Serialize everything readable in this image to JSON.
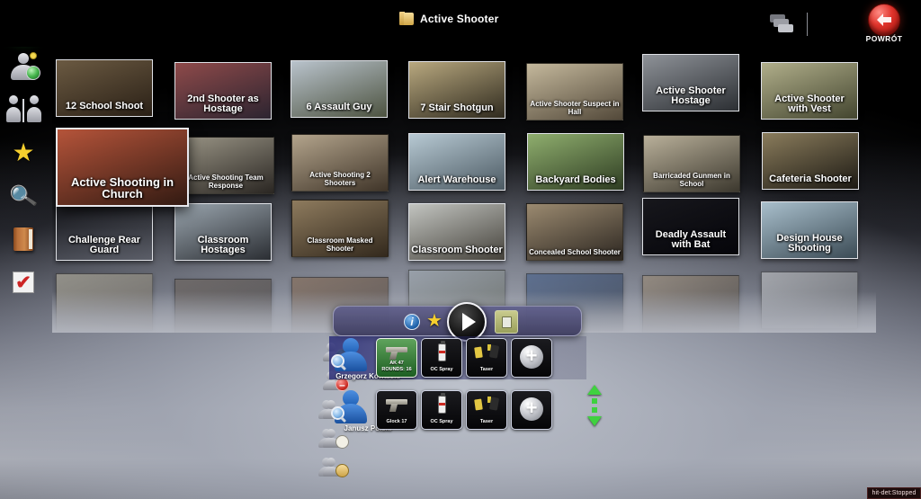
{
  "header": {
    "title": "Active Shooter",
    "folder_icon": "folder-icon",
    "cascade_view_icon": "cascade-view-icon",
    "grid_view_icon": "grid-view-icon",
    "back_button_label": "POWRÓT",
    "back_button_icon": "back-arrow-icon"
  },
  "sidebar": {
    "items": [
      {
        "name": "logo",
        "icon": "film-reel-logo-icon"
      },
      {
        "name": "record-participant",
        "icon": "person-record-icon"
      },
      {
        "name": "compare-participants",
        "icon": "two-persons-split-icon"
      },
      {
        "name": "favorites",
        "icon": "star-icon"
      },
      {
        "name": "search",
        "icon": "magnifier-icon"
      },
      {
        "name": "library",
        "icon": "book-icon"
      },
      {
        "name": "results",
        "icon": "red-check-icon"
      }
    ]
  },
  "grid": {
    "rows": [
      {
        "items": [
          {
            "label": "12 School Shoot",
            "style": "med"
          },
          {
            "label": "2nd Shooter as Hostage",
            "style": "med"
          },
          {
            "label": "6 Assault Guy",
            "style": "med"
          },
          {
            "label": "7 Stair Shotgun",
            "style": "med"
          },
          {
            "label": "Active Shooter Suspect in Hall",
            "style": "small"
          },
          {
            "label": "Active Shooter Hostage",
            "style": "med"
          },
          {
            "label": "Active Shooter with Vest",
            "style": "med"
          }
        ]
      },
      {
        "items": [
          {
            "label": "Active Shooting in Church",
            "style": "big"
          },
          {
            "label": "Active Shooting Team Response",
            "style": "small"
          },
          {
            "label": "Active Shooting 2 Shooters",
            "style": "small"
          },
          {
            "label": "Alert Warehouse",
            "style": "med"
          },
          {
            "label": "Backyard Bodies",
            "style": "med"
          },
          {
            "label": "Barricaded Gunmen in School",
            "style": "small"
          },
          {
            "label": "Cafeteria Shooter",
            "style": "med"
          }
        ]
      },
      {
        "items": [
          {
            "label": "Challenge Rear Guard",
            "style": "med"
          },
          {
            "label": "Classroom Hostages",
            "style": "med"
          },
          {
            "label": "Classroom Masked Shooter",
            "style": "small"
          },
          {
            "label": "Classroom Shooter",
            "style": "med"
          },
          {
            "label": "Concealed School Shooter",
            "style": "small"
          },
          {
            "label": "Deadly Assault with Bat",
            "style": "med"
          },
          {
            "label": "Design House Shooting",
            "style": "med"
          }
        ]
      },
      {
        "items": [
          {
            "label": "",
            "style": "small"
          },
          {
            "label": "",
            "style": "small"
          },
          {
            "label": "",
            "style": "small"
          },
          {
            "label": "",
            "style": "small"
          },
          {
            "label": "",
            "style": "small"
          },
          {
            "label": "",
            "style": "small"
          },
          {
            "label": "",
            "style": "small"
          }
        ]
      }
    ]
  },
  "player_controls": {
    "info_label": "i",
    "info_icon": "info-icon",
    "favorite_icon": "star-icon",
    "play_icon": "play-icon",
    "scenario_icon": "seat-icon"
  },
  "participants_panel": {
    "actions": [
      {
        "name": "add-participant",
        "icon": "person-add-icon",
        "badge": "+"
      },
      {
        "name": "remove-participant",
        "icon": "person-remove-icon",
        "badge": "–"
      },
      {
        "name": "delete-group",
        "icon": "group-delete-icon",
        "badge": "✕"
      },
      {
        "name": "save-group",
        "icon": "group-save-icon",
        "badge": ""
      },
      {
        "name": "load-group",
        "icon": "group-load-icon",
        "badge": ""
      }
    ],
    "people": [
      {
        "name": "Grzegorz Kowalski",
        "selected": true,
        "slots": [
          {
            "label": "AK 47\nROUNDS: 16",
            "icon": "rifle-icon",
            "active": true
          },
          {
            "label": "OC Spray",
            "icon": "spray-icon",
            "active": false
          },
          {
            "label": "Taser",
            "icon": "taser-icon",
            "active": false
          },
          {
            "label": "",
            "icon": "add-weapon-icon",
            "active": false
          }
        ]
      },
      {
        "name": "Janusz Polski",
        "selected": false,
        "slots": [
          {
            "label": "Glock 17",
            "icon": "pistol-icon",
            "active": false
          },
          {
            "label": "OC Spray",
            "icon": "spray-icon",
            "active": false
          },
          {
            "label": "Taser",
            "icon": "taser-icon",
            "active": false
          },
          {
            "label": "",
            "icon": "add-weapon-icon",
            "active": false
          }
        ]
      }
    ],
    "scroll_up_icon": "arrow-up-icon",
    "scroll_down_icon": "arrow-down-icon"
  },
  "status_bar": {
    "text": "hit-det:Stopped"
  },
  "colors": {
    "accent_green": "#3fd13f",
    "back_red": "#e0342c",
    "selection_blue": "#2c2e78",
    "active_slot_green": "#5fa35c"
  }
}
